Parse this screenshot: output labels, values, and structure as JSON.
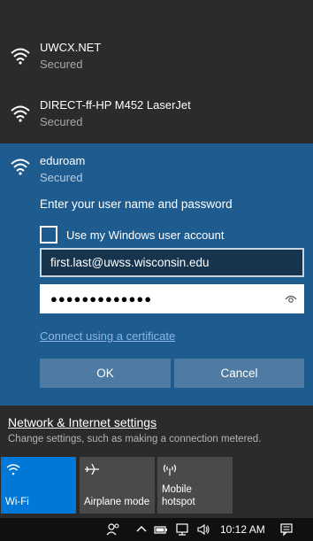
{
  "networks": [
    {
      "name": "UWCX.NET",
      "status": "Secured"
    },
    {
      "name": "DIRECT-ff-HP M452 LaserJet",
      "status": "Secured"
    }
  ],
  "active_network": {
    "name": "eduroam",
    "status": "Secured",
    "prompt": "Enter your user name and password",
    "checkbox_label": "Use my Windows user account",
    "checkbox_checked": false,
    "username_value": "first.last@uwss.wisconsin.edu",
    "password_mask": "●●●●●●●●●●●●●",
    "cert_link": "Connect using a certificate",
    "ok_label": "OK",
    "cancel_label": "Cancel"
  },
  "settings": {
    "title": "Network & Internet settings",
    "description": "Change settings, such as making a connection metered."
  },
  "quick_actions": [
    {
      "label": "Wi-Fi",
      "icon": "wifi-icon",
      "active": true
    },
    {
      "label": "Airplane mode",
      "icon": "airplane-icon",
      "active": false
    },
    {
      "label_line1": "Mobile",
      "label_line2": "hotspot",
      "icon": "hotspot-icon",
      "active": false
    }
  ],
  "taskbar": {
    "time": "10:12 AM",
    "icons": [
      "people-icon",
      "chevron-up-icon",
      "battery-icon",
      "network-icon",
      "volume-icon",
      "action-center-icon"
    ]
  },
  "colors": {
    "accent": "#0078d7",
    "selected_bg": "#1e5b8f",
    "flyout_bg": "#2b2b2b"
  }
}
